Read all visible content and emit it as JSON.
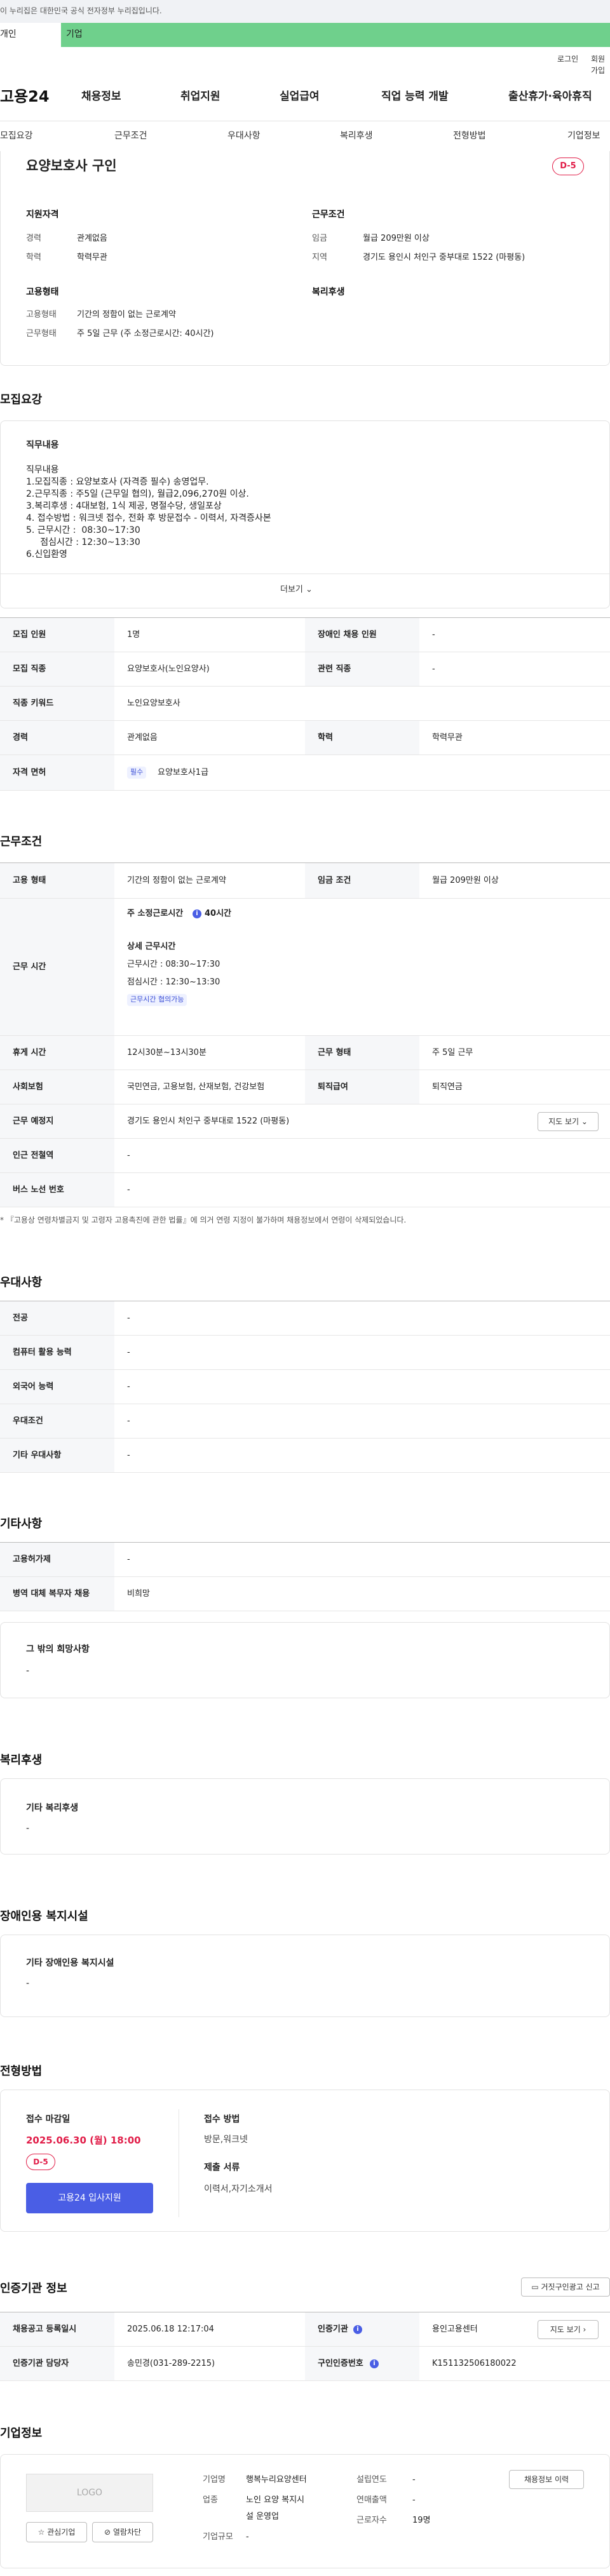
{
  "gov_banner": "이 누리집은 대한민국 공식 전자정부 누리집입니다.",
  "tabs": {
    "first": "개인",
    "second": "기업"
  },
  "util": {
    "login": "로그인",
    "join": "회원가입"
  },
  "logo": "고용24",
  "gnb": [
    "채용정보",
    "취업지원",
    "실업급여",
    "직업 능력 개발",
    "출산휴가·육아휴직"
  ],
  "snb": [
    "모집요강",
    "근무조건",
    "우대사항",
    "복리후생",
    "전형방법",
    "기업정보"
  ],
  "job": {
    "title": "요양보호사 구인",
    "dday": "D-5",
    "qual_title": "지원자격",
    "career_label": "경력",
    "career_value": "관계없음",
    "edu_label": "학력",
    "edu_value": "학력무관",
    "emptype_title": "고용형태",
    "emptype_label": "고용형태",
    "emptype_value": "기간의 정함이 없는 근로계약",
    "work_label": "근무형태",
    "work_value": "주 5일 근무 (주 소정근로시간: 40시간)",
    "cond_title": "근무조건",
    "wage_label": "임금",
    "wage_value": "월급 209만원 이상",
    "region_label": "지역",
    "region_value": "경기도 용인시 처인구 중부대로 1522 (마평동)",
    "welfare_title": "복리후생"
  },
  "recruit": {
    "title": "모집요강",
    "duty_title": "직무내용",
    "duty_lines": [
      "직무내용",
      "1.모집직종 : 요양보호사 (자격증 필수) 송영업무.",
      "2.근무직종 : 주5일 (근무일 협의), 월급2,096,270원 이상.",
      "3.복리후생 : 4대보험, 1식 제공, 명절수당, 생일포상",
      "4. 접수방법 : 워크넷 접수, 전화 후 방문접수 - 이력서, 자격증사본",
      "5. 근무시간 :  08:30~17:30",
      "     점심시간 : 12:30~13:30",
      "6.신입환영"
    ],
    "more": "더보기",
    "rows": [
      {
        "l1": "모집 인원",
        "v1": "1명",
        "l2": "장애인 채용 인원",
        "v2": "-"
      },
      {
        "l1": "모집 직종",
        "v1": "요양보호사(노인요양사)",
        "l2": "관련 직종",
        "v2": "-"
      },
      {
        "l1": "직종 키워드",
        "v1": "노인요양보호사"
      },
      {
        "l1": "경력",
        "v1": "관계없음",
        "l2": "학력",
        "v2": "학력무관"
      },
      {
        "l1": "자격 면허",
        "pill": "필수",
        "v1": "요양보호사1급"
      }
    ]
  },
  "work": {
    "title": "근무조건",
    "emp_label": "고용 형태",
    "emp_value": "기간의 정함이 없는 근로계약",
    "wage_label": "임금 조건",
    "wage_value": "월급 209만원 이상",
    "time_label": "근무 시간",
    "weekly": "주 소정근로시간",
    "weekly_val": "40시간",
    "detail_title": "상세 근무시간",
    "detail1": "근무시간 :  08:30~17:30",
    "detail2": "점심시간 :  12:30~13:30",
    "pill": "근무시간 협의가능",
    "rest_label": "휴게 시간",
    "rest_value": "12시30분~13시30분",
    "form_label": "근무 형태",
    "form_value": "주 5일 근무",
    "ins_label": "사회보험",
    "ins_value": "국민연금, 고용보험, 산재보험, 건강보험",
    "ret_label": "퇴직급여",
    "ret_value": "퇴직연금",
    "place_label": "근무 예정지",
    "place_value": "경기도 용인시 처인구 중부대로 1522 (마평동)",
    "map_btn": "지도 보기",
    "subway_label": "인근 전철역",
    "subway_value": "-",
    "bus_label": "버스 노선 번호",
    "bus_value": "-",
    "note": "* 『고용상 연령차별금지 및 고령자 고용촉진에 관한 법률』에 의거 연령 지정이 불가하며 채용정보에서 연령이 삭제되었습니다."
  },
  "pref": {
    "title": "우대사항",
    "rows": [
      {
        "l": "전공",
        "v": "-"
      },
      {
        "l": "컴퓨터 활용 능력",
        "v": "-"
      },
      {
        "l": "외국어 능력",
        "v": "-"
      },
      {
        "l": "우대조건",
        "v": "-"
      },
      {
        "l": "기타 우대사항",
        "v": "-"
      }
    ]
  },
  "etc": {
    "title": "기타사항",
    "rows": [
      {
        "l": "고용허가제",
        "v": "-"
      },
      {
        "l": "병역 대체 복무자 채용",
        "v": "비희망"
      }
    ],
    "other_title": "그 밖의 희망사항",
    "other_value": "-"
  },
  "welfare": {
    "title": "복리후생",
    "box_title": "기타 복리후생",
    "box_value": "-"
  },
  "disab": {
    "title": "장애인용 복지시설",
    "box_title": "기타 장애인용 복지시설",
    "box_value": "-"
  },
  "process": {
    "title": "전형방법",
    "deadline_title": "접수 마감일",
    "deadline": "2025.06.30 (월) 18:00",
    "dday": "D-5",
    "apply_btn": "고용24 입사지원",
    "method_title": "접수 방법",
    "method_value": "방문,워크넷",
    "docs_title": "제출 서류",
    "docs_value": "이력서,자기소개서"
  },
  "cert": {
    "title": "인증기관 정보",
    "report_btn": "거짓구인광고 신고",
    "reg_label": "채용공고 등록일시",
    "reg_value": "2025.06.18 12:17:04",
    "org_label": "인증기관",
    "org_value": "용인고용센터",
    "map_btn": "지도 보기",
    "mgr_label": "인증기관 담당자",
    "mgr_value": "송민경(031-289-2215)",
    "num_label": "구인인증번호",
    "num_value": "K151132506180022"
  },
  "company": {
    "title": "기업정보",
    "logo_text": "LOGO",
    "fav_btn": "관심기업",
    "block_btn": "열람차단",
    "name_label": "기업명",
    "name_value": "행복누리요양센터",
    "year_label": "설립연도",
    "year_value": "-",
    "hire_btn": "채용정보 이력",
    "ind_label": "업종",
    "ind_value1": "노인 요양 복지시",
    "ind_value2": "설 운영업",
    "sales_label": "연매출액",
    "sales_value": "-",
    "emp_label": "근로자수",
    "emp_value": "19명",
    "size_label": "기업규모",
    "size_value": "-"
  }
}
